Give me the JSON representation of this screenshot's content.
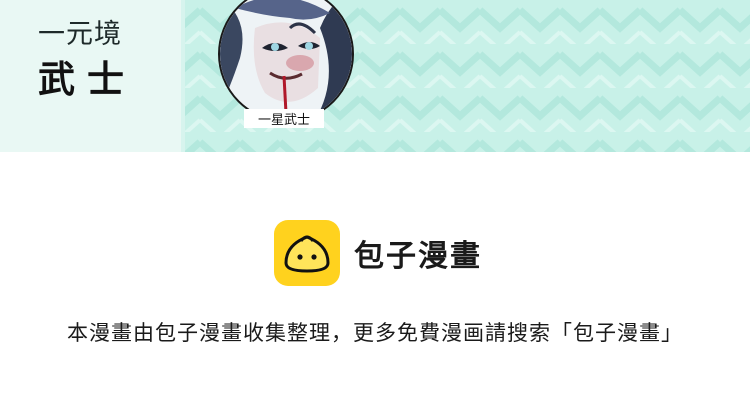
{
  "banner": {
    "realm": "一元境",
    "rank": "武士",
    "portrait_caption": "一星武士",
    "colors": {
      "background": "#c8f1e8",
      "panel": "#e9f8f4"
    }
  },
  "brand": {
    "name": "包子漫畫",
    "icon": "steamed-bun-icon",
    "accent": "#ffd21e"
  },
  "notice": "本漫畫由包子漫畫收集整理，更多免費漫画請搜索「包子漫畫」"
}
